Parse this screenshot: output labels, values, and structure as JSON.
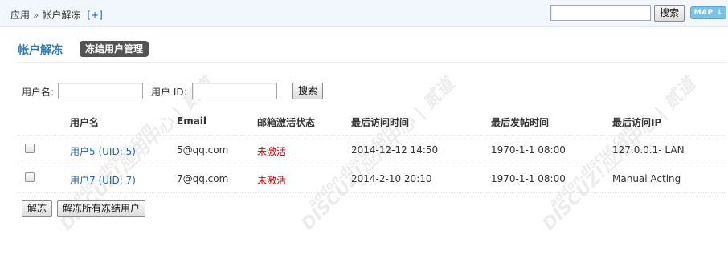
{
  "breadcrumb": {
    "root": "应用",
    "separator": "»",
    "current": "帐户解冻",
    "add_link": "[+]"
  },
  "top_search": {
    "input_value": "",
    "button_label": "搜索",
    "map_label": "MAP ↓"
  },
  "header": {
    "title": "帐户解冻",
    "pill_label": "冻结用户管理"
  },
  "search_form": {
    "username_label": "用户名:",
    "username_value": "",
    "uid_label": "用户 ID:",
    "uid_value": "",
    "button_label": "搜索"
  },
  "table": {
    "columns": [
      "用户名",
      "Email",
      "邮箱激活状态",
      "最后访问时间",
      "最后发帖时间",
      "最后访问IP"
    ],
    "rows": [
      {
        "username": "用户5",
        "uid": "(UID: 5)",
        "email": "5@qq.com",
        "status": "未激活",
        "last_visit": "2014-12-12 14:50",
        "last_post": "1970-1-1 08:00",
        "last_ip": "127.0.0.1- LAN"
      },
      {
        "username": "用户7",
        "uid": "(UID: 7)",
        "email": "7@qq.com",
        "status": "未激活",
        "last_visit": "2014-2-10 20:10",
        "last_post": "1970-1-1 08:00",
        "last_ip": "Manual Acting"
      }
    ]
  },
  "actions": {
    "unfreeze_label": "解冻",
    "unfreeze_all_label": "解冻所有冻结用户"
  },
  "watermark": {
    "text": "DISCUZ!应用中心 | 贰道",
    "subtext": "addon.discuz.com"
  },
  "colors": {
    "link": "#2366a8",
    "title": "#2a7cb8",
    "inactive": "#cc0000",
    "topbar_bg": "#f1f7fc"
  }
}
